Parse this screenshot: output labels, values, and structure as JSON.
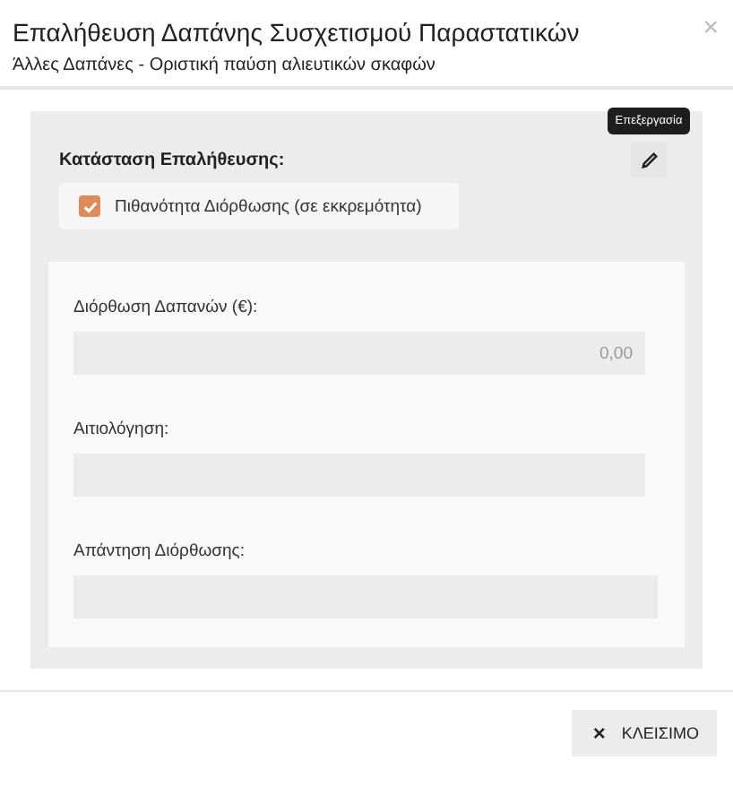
{
  "dialog": {
    "title": "Επαλήθευση Δαπάνης Συσχετισμού Παραστατικών",
    "subtitle": "Άλλες Δαπάνες - Οριστική παύση αλιευτικών σκαφών",
    "close_glyph": "×"
  },
  "status": {
    "label": "Κατάσταση Επαλήθευσης:",
    "edit_tooltip": "Επεξεργασία",
    "option": {
      "label": "Πιθανότητα Διόρθωσης (σε εκκρεμότητα)",
      "checked": true
    }
  },
  "fields": [
    {
      "label": "Διόρθωση Δαπανών (€):",
      "value": "0,00",
      "wide": false
    },
    {
      "label": "Αιτιολόγηση:",
      "wide": false
    },
    {
      "label": "Απάντηση Διόρθωσης:",
      "wide": true
    }
  ],
  "footer": {
    "close_button": {
      "glyph": "×",
      "label": "ΚΛΕΙΣΙΜΟ"
    }
  }
}
